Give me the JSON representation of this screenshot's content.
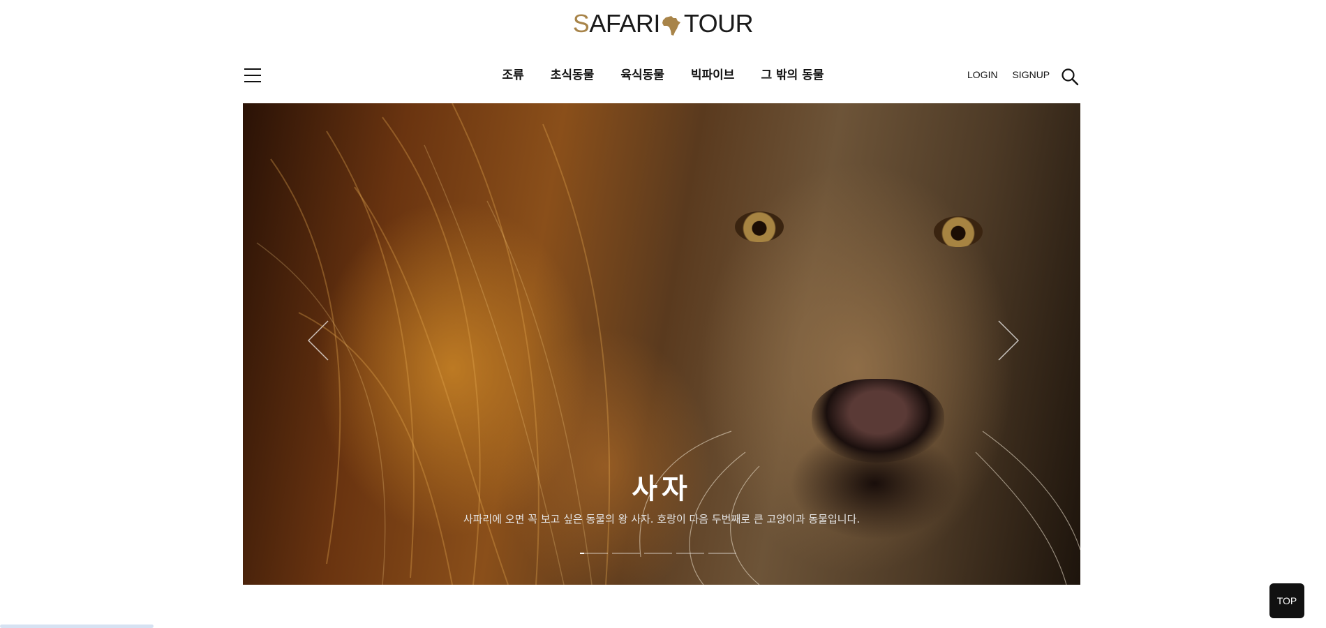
{
  "logo": {
    "first_letter": "S",
    "rest_first": "AFARI",
    "rest_second": "TOUR",
    "icon": "africa-icon",
    "accent_color": "#a88449"
  },
  "nav": {
    "items": [
      "조류",
      "초식동물",
      "육식동물",
      "빅파이브",
      "그 밖의 동물"
    ]
  },
  "util": {
    "login": "LOGIN",
    "signup": "SIGNUP",
    "search_icon": "search-icon",
    "menu_icon": "hamburger-menu-icon"
  },
  "hero": {
    "title": "사자",
    "description": "사파리에 오면 꼭 보고 싶은 동물의 왕 사자. 호랑이 다음 두번째로 큰 고양이과 동물입니다.",
    "slide_count": 5,
    "active_slide": 1,
    "prev_icon": "chevron-left-icon",
    "next_icon": "chevron-right-icon"
  },
  "top_button": {
    "label": "TOP"
  }
}
